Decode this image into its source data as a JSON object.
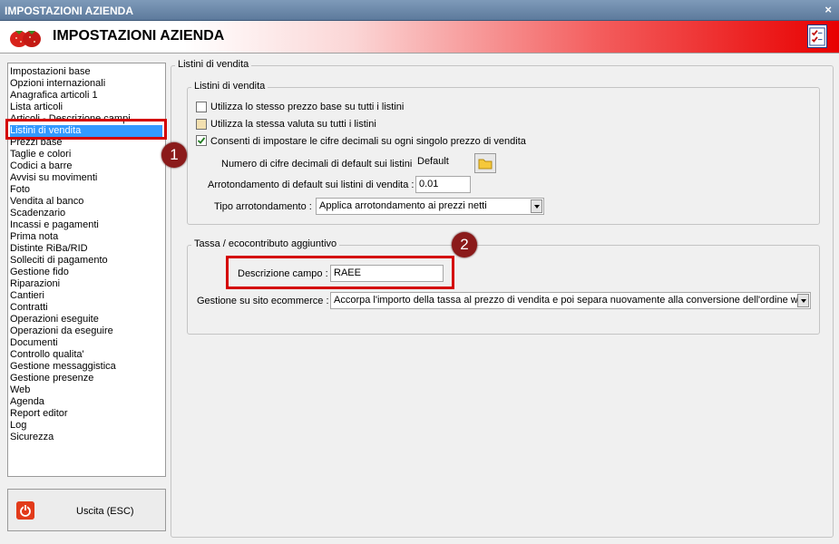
{
  "window": {
    "title": "IMPOSTAZIONI AZIENDA",
    "close_glyph": "×"
  },
  "header": {
    "title": "IMPOSTAZIONI AZIENDA",
    "logo_icon": "strawberry-icon",
    "right_icon": "checklist-icon"
  },
  "sidebar": {
    "items": [
      "Impostazioni base",
      "Opzioni internazionali",
      "Anagrafica articoli 1",
      "Lista articoli",
      "Articoli - Descrizione campi",
      "Listini di vendita",
      "Prezzi base",
      "Taglie e colori",
      "Codici a barre",
      "Avvisi su movimenti",
      "Foto",
      "Vendita al banco",
      "Scadenzario",
      "Incassi e pagamenti",
      "Prima nota",
      "Distinte RiBa/RID",
      "Solleciti di pagamento",
      "Gestione fido",
      "Riparazioni",
      "Cantieri",
      "Contratti",
      "Operazioni eseguite",
      "Operazioni da eseguire",
      "Documenti",
      "Controllo qualita'",
      "Gestione messaggistica",
      "Gestione presenze",
      "Web",
      "Agenda",
      "Report editor",
      "Log",
      "Sicurezza"
    ],
    "selected": "Listini di vendita"
  },
  "exit_button": {
    "label": "Uscita (ESC)",
    "icon": "power-icon"
  },
  "main": {
    "outer_legend": "Listini di vendita",
    "group1": {
      "legend": "Listini di vendita",
      "chk1": {
        "label": "Utilizza lo stesso prezzo base su tutti i listini",
        "checked": false
      },
      "chk2": {
        "label": "Utilizza la stessa valuta su tutti i listini",
        "checked": false
      },
      "chk3": {
        "label": "Consenti di impostare le cifre decimali su ogni singolo prezzo di vendita",
        "checked": true
      },
      "decimals_label": "Numero di cifre decimali di default sui listini :",
      "decimals_value": "Default",
      "rounding_label": "Arrotondamento di default sui listini di vendita :",
      "rounding_value": "0.01",
      "rounding_type_label": "Tipo arrotondamento :",
      "rounding_type_value": "Applica arrotondamento ai prezzi netti"
    },
    "group2": {
      "legend": "Tassa / ecocontributo aggiuntivo",
      "desc_label": "Descrizione campo :",
      "desc_value": "RAEE",
      "ecom_label": "Gestione su sito ecommerce :",
      "ecom_value": "Accorpa l'importo della tassa al prezzo di vendita e poi separa nuovamente alla conversione dell'ordine web"
    }
  },
  "annotations": {
    "badge1": "1",
    "badge2": "2"
  }
}
